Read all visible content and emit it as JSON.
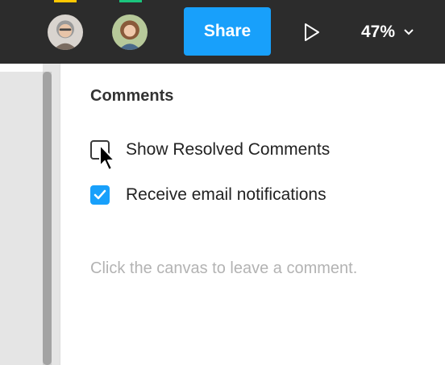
{
  "toolbar": {
    "share_label": "Share",
    "zoom_label": "47%",
    "colors": {
      "background": "#2c2c2c",
      "share": "#18a0fb"
    },
    "presence_colors": [
      "#ffc700",
      "#1bc47d"
    ]
  },
  "comments_panel": {
    "title": "Comments",
    "options": [
      {
        "label": "Show Resolved Comments",
        "checked": false
      },
      {
        "label": "Receive email notifications",
        "checked": true
      }
    ],
    "hint": "Click the canvas to leave a comment."
  },
  "icons": [
    "play-icon",
    "chevron-down-icon",
    "checkmark-icon",
    "mouse-pointer-icon"
  ]
}
